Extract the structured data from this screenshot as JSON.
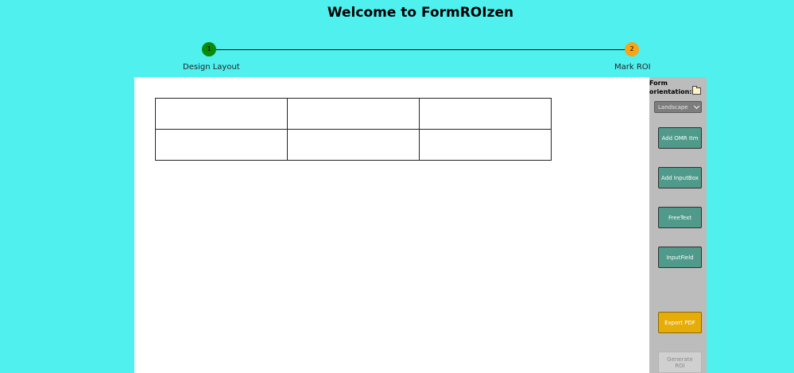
{
  "header": {
    "title": "Welcome to FormROIzen"
  },
  "stepper": {
    "steps": [
      {
        "number": "1",
        "label": "Design Layout"
      },
      {
        "number": "2",
        "label": "Mark ROI"
      }
    ]
  },
  "panel": {
    "orientation_label": "Form orientation:",
    "orientation_value": "Landscape",
    "buttons": {
      "add_omr": "Add OMR Itm",
      "add_inputbox": "Add InputBox",
      "freetext": "FreeText",
      "inputfield": "InputField",
      "export_pdf": "Export PDF",
      "generate_roi": "Generate ROI"
    }
  },
  "colors": {
    "background": "#50f0ef",
    "step1": "#0a8a0a",
    "step2": "#f7a517",
    "button_teal": "#4f9a8a",
    "button_export": "#e6ad08"
  },
  "icons": {
    "orientation": "folder-icon",
    "select": "chevron-down-icon"
  }
}
